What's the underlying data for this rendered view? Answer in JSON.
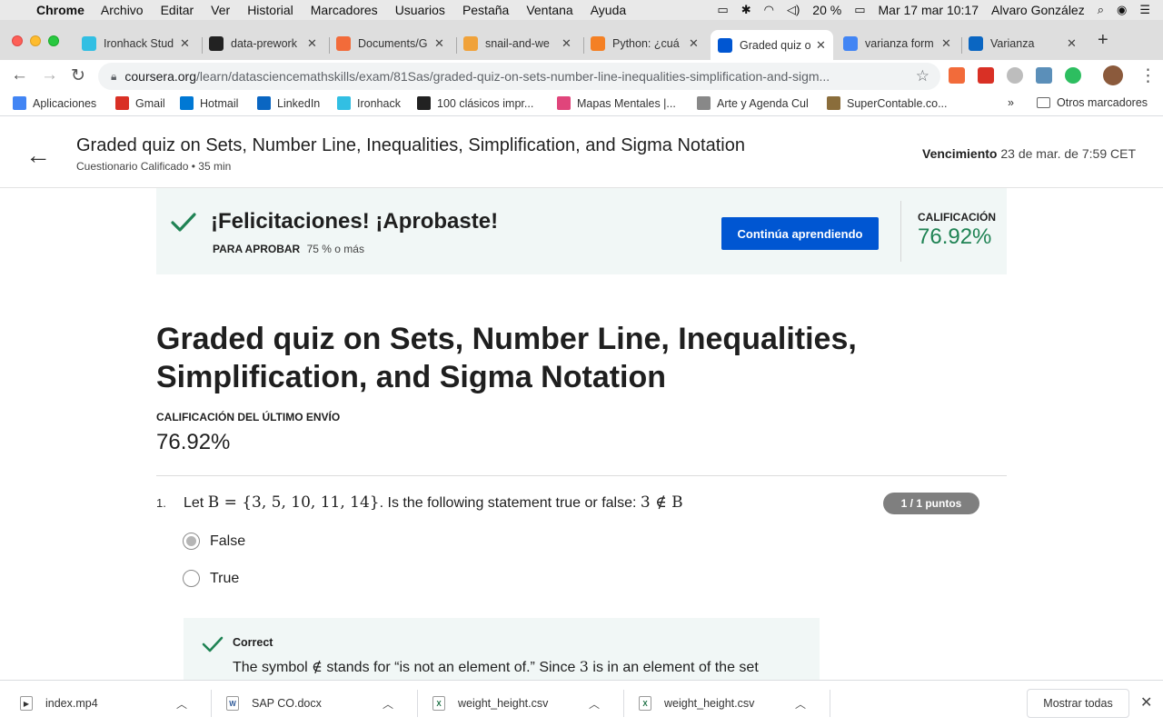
{
  "menubar": {
    "app": "Chrome",
    "items": [
      "Archivo",
      "Editar",
      "Ver",
      "Historial",
      "Marcadores",
      "Usuarios",
      "Pestaña",
      "Ventana",
      "Ayuda"
    ],
    "battery": "20 %",
    "datetime": "Mar 17 mar  10:17",
    "user": "Alvaro González"
  },
  "tabs": [
    {
      "label": "Ironhack Stud",
      "color": "#32bfe3"
    },
    {
      "label": "data-prework",
      "color": "#222222"
    },
    {
      "label": "Documents/G",
      "color": "#f26b3a"
    },
    {
      "label": "snail-and-we",
      "color": "#f0a23a"
    },
    {
      "label": "Python: ¿cuá",
      "color": "#f48024"
    },
    {
      "label": "Graded quiz o",
      "color": "#0056d2",
      "active": true
    },
    {
      "label": "varianza form",
      "color": "#4285f4"
    },
    {
      "label": "Varianza",
      "color": "#0a66c2"
    }
  ],
  "address": {
    "host": "coursera.org",
    "path": "/learn/datasciencemathskills/exam/81Sas/graded-quiz-on-sets-number-line-inequalities-simplification-and-sigm..."
  },
  "bookmarks": [
    {
      "label": "Aplicaciones",
      "icon": "apps-grid-icon",
      "color": "#4285f4"
    },
    {
      "label": "Gmail",
      "icon": "gmail-icon",
      "color": "#d93025"
    },
    {
      "label": "Hotmail",
      "icon": "outlook-icon",
      "color": "#0078d4"
    },
    {
      "label": "LinkedIn",
      "icon": "linkedin-icon",
      "color": "#0a66c2"
    },
    {
      "label": "Ironhack",
      "icon": "ironhack-icon",
      "color": "#32bfe3"
    },
    {
      "label": "100 clásicos impr...",
      "icon": "bookmark-k-icon",
      "color": "#222222"
    },
    {
      "label": "Mapas Mentales |...",
      "icon": "mindmap-icon",
      "color": "#e0457b"
    },
    {
      "label": "Arte y Agenda Cul",
      "icon": "folder-icon",
      "color": "#888888"
    },
    {
      "label": "SuperContable.co...",
      "icon": "supercontable-icon",
      "color": "#8a6d3b"
    }
  ],
  "bookmarks_more": "»",
  "bookmarks_other": "Otros marcadores",
  "header": {
    "title": "Graded quiz on Sets, Number Line, Inequalities, Simplification, and Sigma Notation",
    "subtitle": "Cuestionario Calificado • 35 min",
    "due_label": "Vencimiento",
    "due_value": "23 de mar. de 7:59 CET"
  },
  "banner": {
    "message": "¡Felicitaciones! ¡Aprobaste!",
    "pass_label": "PARA APROBAR",
    "pass_value": "75 % o más",
    "button": "Continúa aprendiendo",
    "grade_label": "CALIFICACIÓN",
    "grade_value": "76.92%",
    "accent": "#1f8354"
  },
  "main": {
    "title": "Graded quiz on Sets, Number Line, Inequalities, Simplification, and Sigma Notation",
    "last_label": "CALIFICACIÓN DEL ÚLTIMO ENVÍO",
    "last_value": "76.92%"
  },
  "question": {
    "number": "1.",
    "text_prefix": "Let ",
    "text_math1": "B = {3, 5, 10, 11, 14}",
    "text_mid": ". Is the following statement true or false: ",
    "text_math2": "3 ∉ B",
    "points": "1 / 1 puntos",
    "options": [
      {
        "label": "False",
        "selected": true
      },
      {
        "label": "True",
        "selected": false
      }
    ],
    "feedback_title": "Correct",
    "feedback_pre": "The symbol ",
    "feedback_sym": "∉",
    "feedback_mid": " stands for “is not an element of.” Since ",
    "feedback_num": "3",
    "feedback_post": " is in an element of the set"
  },
  "downloads": [
    {
      "name": "index.mp4",
      "icon": "video-file-icon"
    },
    {
      "name": "SAP CO.docx",
      "icon": "word-file-icon"
    },
    {
      "name": "weight_height.csv",
      "icon": "excel-file-icon"
    },
    {
      "name": "weight_height.csv",
      "icon": "excel-file-icon"
    }
  ],
  "downloads_showall": "Mostrar todas"
}
